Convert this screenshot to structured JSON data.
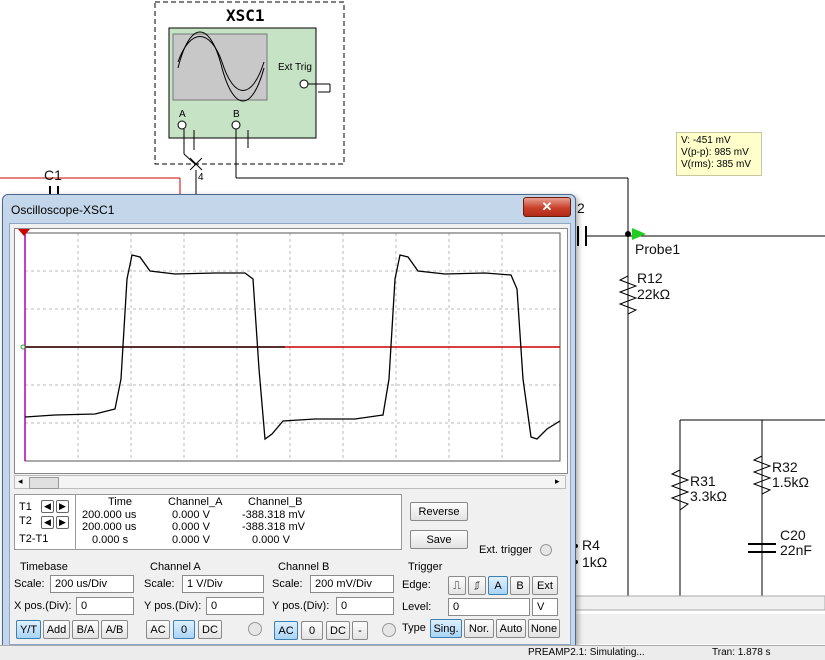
{
  "schematic": {
    "scope_title": "XSC1",
    "ext_trig": "Ext Trig",
    "ch_a": "A",
    "ch_b": "B",
    "wire_label": "4",
    "c1": "C1",
    "c2_partial": "2",
    "probe_name": "Probe1",
    "r12_name": "R12",
    "r12_value": "22kΩ",
    "r31_name": "R31",
    "r31_value": "3.3kΩ",
    "r32_name": "R32",
    "r32_value": "1.5kΩ",
    "c20_name": "C20",
    "c20_value": "22nF",
    "r4_name": "R4",
    "r4_value": "1kΩ"
  },
  "probe": {
    "v": "V: -451 mV",
    "vpp": "V(p-p): 985 mV",
    "vrms": "V(rms): 385 mV"
  },
  "window": {
    "title": "Oscilloscope-XSC1",
    "close": "✕"
  },
  "readout": {
    "headers": [
      "Time",
      "Channel_A",
      "Channel_B"
    ],
    "t1": {
      "label": "T1",
      "time": "200.000 us",
      "a": "0.000 V",
      "b": "-388.318 mV"
    },
    "t2": {
      "label": "T2",
      "time": "200.000 us",
      "a": "0.000 V",
      "b": "-388.318 mV"
    },
    "dt": {
      "label": "T2-T1",
      "time": "0.000 s",
      "a": "0.000 V",
      "b": "0.000 V"
    },
    "reverse": "Reverse",
    "save": "Save",
    "ext_trigger": "Ext. trigger"
  },
  "timebase": {
    "title": "Timebase",
    "scale_label": "Scale:",
    "scale": "200 us/Div",
    "xpos_label": "X pos.(Div):",
    "xpos": "0",
    "modes": [
      "Y/T",
      "Add",
      "B/A",
      "A/B"
    ]
  },
  "channel_a": {
    "title": "Channel A",
    "scale_label": "Scale:",
    "scale": "1 V/Div",
    "ypos_label": "Y pos.(Div):",
    "ypos": "0",
    "coupling": [
      "AC",
      "0",
      "DC"
    ]
  },
  "channel_b": {
    "title": "Channel B",
    "scale_label": "Scale:",
    "scale": "200 mV/Div",
    "ypos_label": "Y pos.(Div):",
    "ypos": "0",
    "coupling": [
      "AC",
      "0",
      "DC",
      "-"
    ]
  },
  "trigger": {
    "title": "Trigger",
    "edge_label": "Edge:",
    "edges": [
      "A",
      "B",
      "Ext"
    ],
    "level_label": "Level:",
    "level": "0",
    "level_unit": "V",
    "type_label": "Type",
    "types": [
      "Sing.",
      "Nor.",
      "Auto",
      "None"
    ]
  },
  "status": {
    "message": "PREAMP2.1: Simulating...",
    "tran": "Tran: 1.878 s"
  },
  "colors": {
    "scope_body": "#c6e3c6",
    "trace_a": "#cc0000",
    "trace_b": "#000000",
    "cursor": "#b000b0",
    "probe_bg": "#ffffcc"
  }
}
